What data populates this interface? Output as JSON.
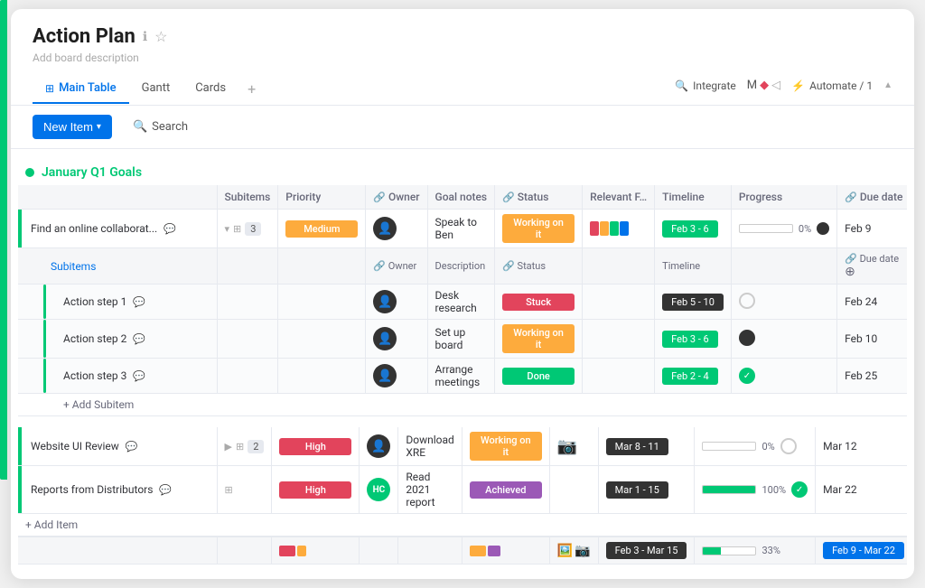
{
  "header": {
    "title": "Action Plan",
    "board_desc": "Add board description",
    "tabs": [
      {
        "label": "Main Table",
        "icon": "⊞",
        "active": true
      },
      {
        "label": "Gantt",
        "icon": "",
        "active": false
      },
      {
        "label": "Cards",
        "icon": "",
        "active": false
      }
    ],
    "nav_add": "+",
    "actions": [
      {
        "label": "Integrate",
        "icon": "🔍"
      },
      {
        "label": "Automate / 1",
        "icon": "⚡"
      }
    ]
  },
  "toolbar": {
    "new_item_label": "New Item",
    "search_label": "Search"
  },
  "groups": [
    {
      "id": "q1",
      "title": "January Q1 Goals",
      "color": "#00c875",
      "columns": [
        "Subitems",
        "Priority",
        "Owner",
        "Goal notes",
        "Status",
        "Relevant F…",
        "Timeline",
        "Progress",
        "Due date"
      ],
      "rows": [
        {
          "id": "row1",
          "name": "Find an online collaborat...",
          "subitems": "3",
          "priority": "Medium",
          "priority_color": "medium",
          "owner": "avatar",
          "notes": "Speak to Ben",
          "status": "Working on it",
          "status_color": "working",
          "relevant": "tile",
          "timeline": "Feb 3 - 6",
          "timeline_color": "timeline-green",
          "progress": 0,
          "due_date": "Feb 9",
          "has_subitems": true
        }
      ],
      "subitems": {
        "columns": [
          "Owner",
          "Description",
          "Status",
          "Timeline",
          "Due date"
        ],
        "rows": [
          {
            "name": "Action step 1",
            "owner": "avatar",
            "desc": "Desk research",
            "status": "Stuck",
            "status_color": "stuck",
            "timeline": "Feb 5 - 10",
            "timeline_color": "timeline-dark",
            "due_date": "Feb 24",
            "circle": "empty"
          },
          {
            "name": "Action step 2",
            "owner": "avatar",
            "desc": "Set up board",
            "status": "Working on it",
            "status_color": "working",
            "timeline": "Feb 3 - 6",
            "timeline_color": "timeline-green",
            "due_date": "Feb 10",
            "circle": "filled"
          },
          {
            "name": "Action step 3",
            "owner": "avatar",
            "desc": "Arrange meetings",
            "status": "Done",
            "status_color": "done",
            "timeline": "Feb 2 - 4",
            "timeline_color": "timeline-green",
            "due_date": "Feb 25",
            "circle": "check"
          }
        ],
        "add_label": "+ Add Subitem"
      }
    },
    {
      "id": "other",
      "title": "",
      "color": "#00c875",
      "rows": [
        {
          "id": "row2",
          "name": "Website UI Review",
          "subitems": "2",
          "priority": "High",
          "priority_color": "high",
          "owner": "avatar",
          "notes": "Download XRE",
          "status": "Working on it",
          "status_color": "working",
          "relevant": "camera",
          "timeline": "Mar 8 - 11",
          "timeline_color": "timeline-dark",
          "progress": 0,
          "due_date": "Mar 12",
          "circle": "empty"
        },
        {
          "id": "row3",
          "name": "Reports from Distributors",
          "subitems": "",
          "priority": "High",
          "priority_color": "high",
          "owner": "hc",
          "notes": "Read 2021 report",
          "status": "Achieved",
          "status_color": "achieved",
          "relevant": "",
          "timeline": "Mar 1 - 15",
          "timeline_color": "timeline-dark",
          "progress": 100,
          "due_date": "Mar 22",
          "circle": "check"
        }
      ],
      "add_item_label": "+ Add Item"
    }
  ],
  "footer": {
    "timeline_summary": "Feb 3 - Mar 15",
    "progress_summary": "33%",
    "due_date_summary": "Feb 9 - Mar 22"
  }
}
